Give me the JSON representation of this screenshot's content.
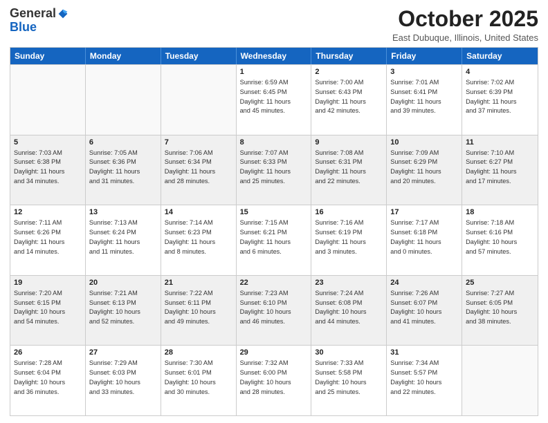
{
  "header": {
    "logo_general": "General",
    "logo_blue": "Blue",
    "month_title": "October 2025",
    "location": "East Dubuque, Illinois, United States"
  },
  "calendar": {
    "days_of_week": [
      "Sunday",
      "Monday",
      "Tuesday",
      "Wednesday",
      "Thursday",
      "Friday",
      "Saturday"
    ],
    "rows": [
      [
        {
          "day": "",
          "text": ""
        },
        {
          "day": "",
          "text": ""
        },
        {
          "day": "",
          "text": ""
        },
        {
          "day": "1",
          "text": "Sunrise: 6:59 AM\nSunset: 6:45 PM\nDaylight: 11 hours\nand 45 minutes."
        },
        {
          "day": "2",
          "text": "Sunrise: 7:00 AM\nSunset: 6:43 PM\nDaylight: 11 hours\nand 42 minutes."
        },
        {
          "day": "3",
          "text": "Sunrise: 7:01 AM\nSunset: 6:41 PM\nDaylight: 11 hours\nand 39 minutes."
        },
        {
          "day": "4",
          "text": "Sunrise: 7:02 AM\nSunset: 6:39 PM\nDaylight: 11 hours\nand 37 minutes."
        }
      ],
      [
        {
          "day": "5",
          "text": "Sunrise: 7:03 AM\nSunset: 6:38 PM\nDaylight: 11 hours\nand 34 minutes."
        },
        {
          "day": "6",
          "text": "Sunrise: 7:05 AM\nSunset: 6:36 PM\nDaylight: 11 hours\nand 31 minutes."
        },
        {
          "day": "7",
          "text": "Sunrise: 7:06 AM\nSunset: 6:34 PM\nDaylight: 11 hours\nand 28 minutes."
        },
        {
          "day": "8",
          "text": "Sunrise: 7:07 AM\nSunset: 6:33 PM\nDaylight: 11 hours\nand 25 minutes."
        },
        {
          "day": "9",
          "text": "Sunrise: 7:08 AM\nSunset: 6:31 PM\nDaylight: 11 hours\nand 22 minutes."
        },
        {
          "day": "10",
          "text": "Sunrise: 7:09 AM\nSunset: 6:29 PM\nDaylight: 11 hours\nand 20 minutes."
        },
        {
          "day": "11",
          "text": "Sunrise: 7:10 AM\nSunset: 6:27 PM\nDaylight: 11 hours\nand 17 minutes."
        }
      ],
      [
        {
          "day": "12",
          "text": "Sunrise: 7:11 AM\nSunset: 6:26 PM\nDaylight: 11 hours\nand 14 minutes."
        },
        {
          "day": "13",
          "text": "Sunrise: 7:13 AM\nSunset: 6:24 PM\nDaylight: 11 hours\nand 11 minutes."
        },
        {
          "day": "14",
          "text": "Sunrise: 7:14 AM\nSunset: 6:23 PM\nDaylight: 11 hours\nand 8 minutes."
        },
        {
          "day": "15",
          "text": "Sunrise: 7:15 AM\nSunset: 6:21 PM\nDaylight: 11 hours\nand 6 minutes."
        },
        {
          "day": "16",
          "text": "Sunrise: 7:16 AM\nSunset: 6:19 PM\nDaylight: 11 hours\nand 3 minutes."
        },
        {
          "day": "17",
          "text": "Sunrise: 7:17 AM\nSunset: 6:18 PM\nDaylight: 11 hours\nand 0 minutes."
        },
        {
          "day": "18",
          "text": "Sunrise: 7:18 AM\nSunset: 6:16 PM\nDaylight: 10 hours\nand 57 minutes."
        }
      ],
      [
        {
          "day": "19",
          "text": "Sunrise: 7:20 AM\nSunset: 6:15 PM\nDaylight: 10 hours\nand 54 minutes."
        },
        {
          "day": "20",
          "text": "Sunrise: 7:21 AM\nSunset: 6:13 PM\nDaylight: 10 hours\nand 52 minutes."
        },
        {
          "day": "21",
          "text": "Sunrise: 7:22 AM\nSunset: 6:11 PM\nDaylight: 10 hours\nand 49 minutes."
        },
        {
          "day": "22",
          "text": "Sunrise: 7:23 AM\nSunset: 6:10 PM\nDaylight: 10 hours\nand 46 minutes."
        },
        {
          "day": "23",
          "text": "Sunrise: 7:24 AM\nSunset: 6:08 PM\nDaylight: 10 hours\nand 44 minutes."
        },
        {
          "day": "24",
          "text": "Sunrise: 7:26 AM\nSunset: 6:07 PM\nDaylight: 10 hours\nand 41 minutes."
        },
        {
          "day": "25",
          "text": "Sunrise: 7:27 AM\nSunset: 6:05 PM\nDaylight: 10 hours\nand 38 minutes."
        }
      ],
      [
        {
          "day": "26",
          "text": "Sunrise: 7:28 AM\nSunset: 6:04 PM\nDaylight: 10 hours\nand 36 minutes."
        },
        {
          "day": "27",
          "text": "Sunrise: 7:29 AM\nSunset: 6:03 PM\nDaylight: 10 hours\nand 33 minutes."
        },
        {
          "day": "28",
          "text": "Sunrise: 7:30 AM\nSunset: 6:01 PM\nDaylight: 10 hours\nand 30 minutes."
        },
        {
          "day": "29",
          "text": "Sunrise: 7:32 AM\nSunset: 6:00 PM\nDaylight: 10 hours\nand 28 minutes."
        },
        {
          "day": "30",
          "text": "Sunrise: 7:33 AM\nSunset: 5:58 PM\nDaylight: 10 hours\nand 25 minutes."
        },
        {
          "day": "31",
          "text": "Sunrise: 7:34 AM\nSunset: 5:57 PM\nDaylight: 10 hours\nand 22 minutes."
        },
        {
          "day": "",
          "text": ""
        }
      ]
    ]
  }
}
